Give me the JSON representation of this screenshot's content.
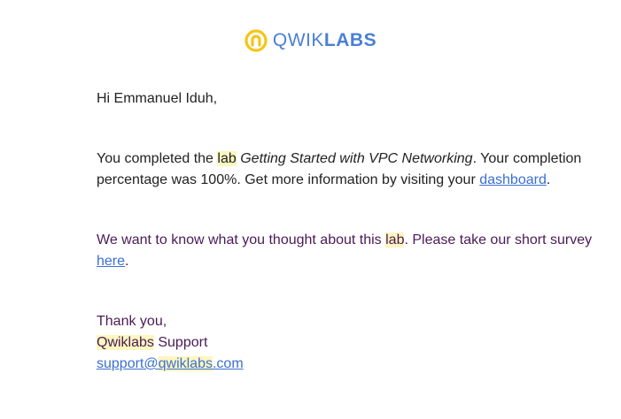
{
  "brand": {
    "logo_thin": "QWIK",
    "logo_bold": "LABS",
    "icon": "qwiklabs-logo-icon",
    "colors": {
      "text": "#4a7fd6",
      "icon": "#f5c518",
      "highlight": "#fcf6c0",
      "link": "#3b6fd1",
      "purple_text": "#4b1a56"
    }
  },
  "email": {
    "greeting": "Hi Emmanuel Iduh,",
    "p1": {
      "part1": "You completed the ",
      "hl_word": "lab",
      "space": " ",
      "course_title": "Getting Started with VPC Networking",
      "part2": ". Your completion percentage was 100%. Get more information by visiting your ",
      "link_text": "dashboard",
      "end": "."
    },
    "p2": {
      "part1": "We want to know what you thought about this ",
      "hl_word": "lab",
      "part2": ". Please take our short survey ",
      "link_text": "here",
      "end": "."
    },
    "signoff": {
      "thanks": "Thank you,",
      "brand_hl": "Qwiklabs",
      "support": " Support",
      "email_pre": "support@",
      "email_hl": "qwiklabs",
      "email_post": ".com"
    }
  }
}
